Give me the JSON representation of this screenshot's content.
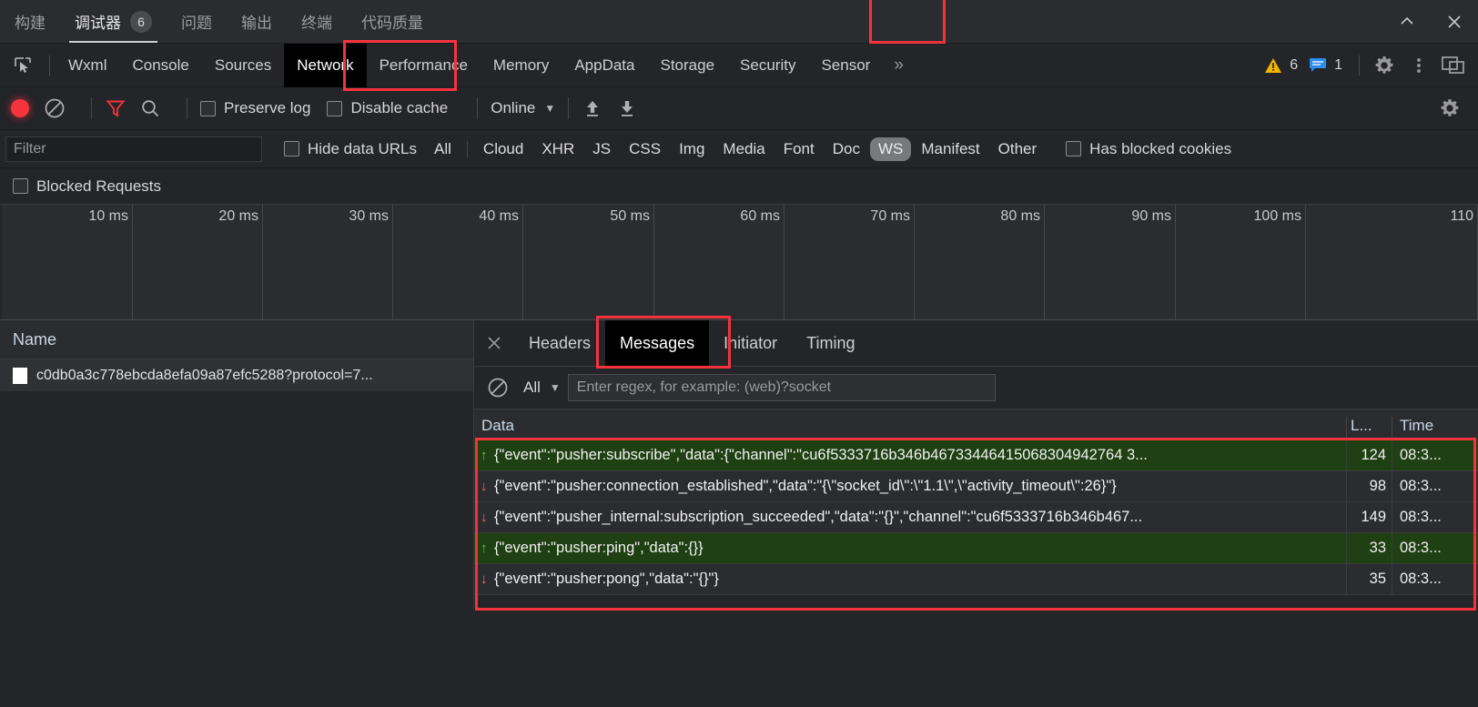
{
  "ide": {
    "tabs": [
      {
        "label": "构建",
        "active": false,
        "badge": null
      },
      {
        "label": "调试器",
        "active": true,
        "badge": "6"
      },
      {
        "label": "问题",
        "active": false,
        "badge": null
      },
      {
        "label": "输出",
        "active": false,
        "badge": null
      },
      {
        "label": "终端",
        "active": false,
        "badge": null
      },
      {
        "label": "代码质量",
        "active": false,
        "badge": null
      }
    ],
    "window_controls": {
      "minimize": "⌃",
      "close": "✕"
    }
  },
  "devtools": {
    "inspect_icon": "inspect-element-icon",
    "tabs": [
      {
        "label": "Wxml",
        "active": false
      },
      {
        "label": "Console",
        "active": false
      },
      {
        "label": "Sources",
        "active": false
      },
      {
        "label": "Network",
        "active": true
      },
      {
        "label": "Performance",
        "active": false
      },
      {
        "label": "Memory",
        "active": false
      },
      {
        "label": "AppData",
        "active": false
      },
      {
        "label": "Storage",
        "active": false
      },
      {
        "label": "Security",
        "active": false
      },
      {
        "label": "Sensor",
        "active": false
      }
    ],
    "more_label": "»",
    "warning_count": "6",
    "message_count": "1",
    "settings_icon": "gear-icon",
    "kebab_icon": "more-vertical-icon",
    "dock_icon": "dock-side-icon"
  },
  "network_toolbar": {
    "record_label": "record-button",
    "clear_label": "clear-button",
    "filter_icon": "funnel-icon",
    "search_icon": "search-icon",
    "preserve_log": "Preserve log",
    "disable_cache": "Disable cache",
    "throttle_value": "Online",
    "import_icon": "upload-har-icon",
    "export_icon": "download-har-icon",
    "settings_icon": "gear-icon"
  },
  "filter_row": {
    "filter_placeholder": "Filter",
    "filter_value": "",
    "hide_data_urls": "Hide data URLs",
    "types": [
      {
        "label": "All",
        "selected": false
      },
      {
        "label": "Cloud",
        "selected": false
      },
      {
        "label": "XHR",
        "selected": false
      },
      {
        "label": "JS",
        "selected": false
      },
      {
        "label": "CSS",
        "selected": false
      },
      {
        "label": "Img",
        "selected": false
      },
      {
        "label": "Media",
        "selected": false
      },
      {
        "label": "Font",
        "selected": false
      },
      {
        "label": "Doc",
        "selected": false
      },
      {
        "label": "WS",
        "selected": true
      },
      {
        "label": "Manifest",
        "selected": false
      },
      {
        "label": "Other",
        "selected": false
      }
    ],
    "has_blocked_cookies": "Has blocked cookies",
    "blocked_requests": "Blocked Requests"
  },
  "timeline": {
    "ticks": [
      "10 ms",
      "20 ms",
      "30 ms",
      "40 ms",
      "50 ms",
      "60 ms",
      "70 ms",
      "80 ms",
      "90 ms",
      "100 ms",
      "110"
    ]
  },
  "requests": {
    "column_name": "Name",
    "rows": [
      {
        "name": "c0db0a3c778ebcda8efa09a87efc5288?protocol=7..."
      }
    ]
  },
  "detail": {
    "close_icon": "close-icon",
    "tabs": [
      {
        "label": "Headers",
        "active": false
      },
      {
        "label": "Messages",
        "active": true
      },
      {
        "label": "Initiator",
        "active": false
      },
      {
        "label": "Timing",
        "active": false
      }
    ],
    "message_toolbar": {
      "clear_icon": "clear-messages-icon",
      "filter_value": "All",
      "regex_placeholder": "Enter regex, for example: (web)?socket",
      "regex_value": ""
    },
    "messages": {
      "columns": [
        "Data",
        "L...",
        "Time"
      ],
      "rows": [
        {
          "direction": "sent",
          "arrow": "↑",
          "data": "{\"event\":\"pusher:subscribe\",\"data\":{\"channel\":\"cu6f5333716b346b46733446415068304942764 3...",
          "length": "124",
          "time": "08:3..."
        },
        {
          "direction": "received",
          "arrow": "↓",
          "data": "{\"event\":\"pusher:connection_established\",\"data\":\"{\\\"socket_id\\\":\\\"1.1\\\",\\\"activity_timeout\\\":26}\"}",
          "length": "98",
          "time": "08:3..."
        },
        {
          "direction": "received",
          "arrow": "↓",
          "data": "{\"event\":\"pusher_internal:subscription_succeeded\",\"data\":\"{}\",\"channel\":\"cu6f5333716b346b467...",
          "length": "149",
          "time": "08:3..."
        },
        {
          "direction": "sent",
          "arrow": "↑",
          "data": "{\"event\":\"pusher:ping\",\"data\":{}}",
          "length": "33",
          "time": "08:3..."
        },
        {
          "direction": "received",
          "arrow": "↓",
          "data": "{\"event\":\"pusher:pong\",\"data\":\"{}\"}",
          "length": "35",
          "time": "08:3..."
        }
      ]
    }
  },
  "colors": {
    "annotation": "#f4333d",
    "sent_row_bg": "#1f4012",
    "selected_filter_bg": "#78797d",
    "record_red": "#f4333d"
  }
}
